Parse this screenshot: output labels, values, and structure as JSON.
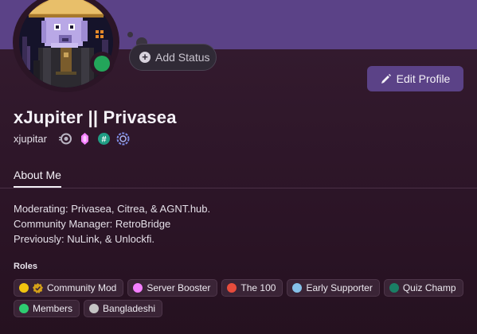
{
  "profile": {
    "display_name": "xJupiter || Privasea",
    "username": "xjupitar",
    "add_status_label": "Add Status",
    "edit_profile_label": "Edit Profile",
    "status": "online",
    "badges": [
      "nitro-orbit-badge",
      "boost-gem-badge",
      "hashtag-badge",
      "quest-badge"
    ]
  },
  "tabs": {
    "about_me": "About Me"
  },
  "about": {
    "lines": [
      "Moderating: Privasea, Citrea, & AGNT.hub.",
      "Community Manager: RetroBridge",
      "Previously: NuLink, & Unlockfi."
    ]
  },
  "roles": {
    "heading": "Roles",
    "items": [
      {
        "label": "Community Mod",
        "color": "#f1c40f",
        "verified": true
      },
      {
        "label": "Server Booster",
        "color": "#f47fff"
      },
      {
        "label": "The 100",
        "color": "#e74c3c"
      },
      {
        "label": "Early Supporter",
        "color": "#85c1e9"
      },
      {
        "label": "Quiz Champ",
        "color": "#1a7f65"
      },
      {
        "label": "Members",
        "color": "#2ecc71"
      },
      {
        "label": "Bangladeshi",
        "color": "#c4c4c4"
      }
    ]
  },
  "colors": {
    "banner": "#5b4287",
    "panel": "#2b1526",
    "accent_button": "#5b4287",
    "online": "#23a55a"
  }
}
